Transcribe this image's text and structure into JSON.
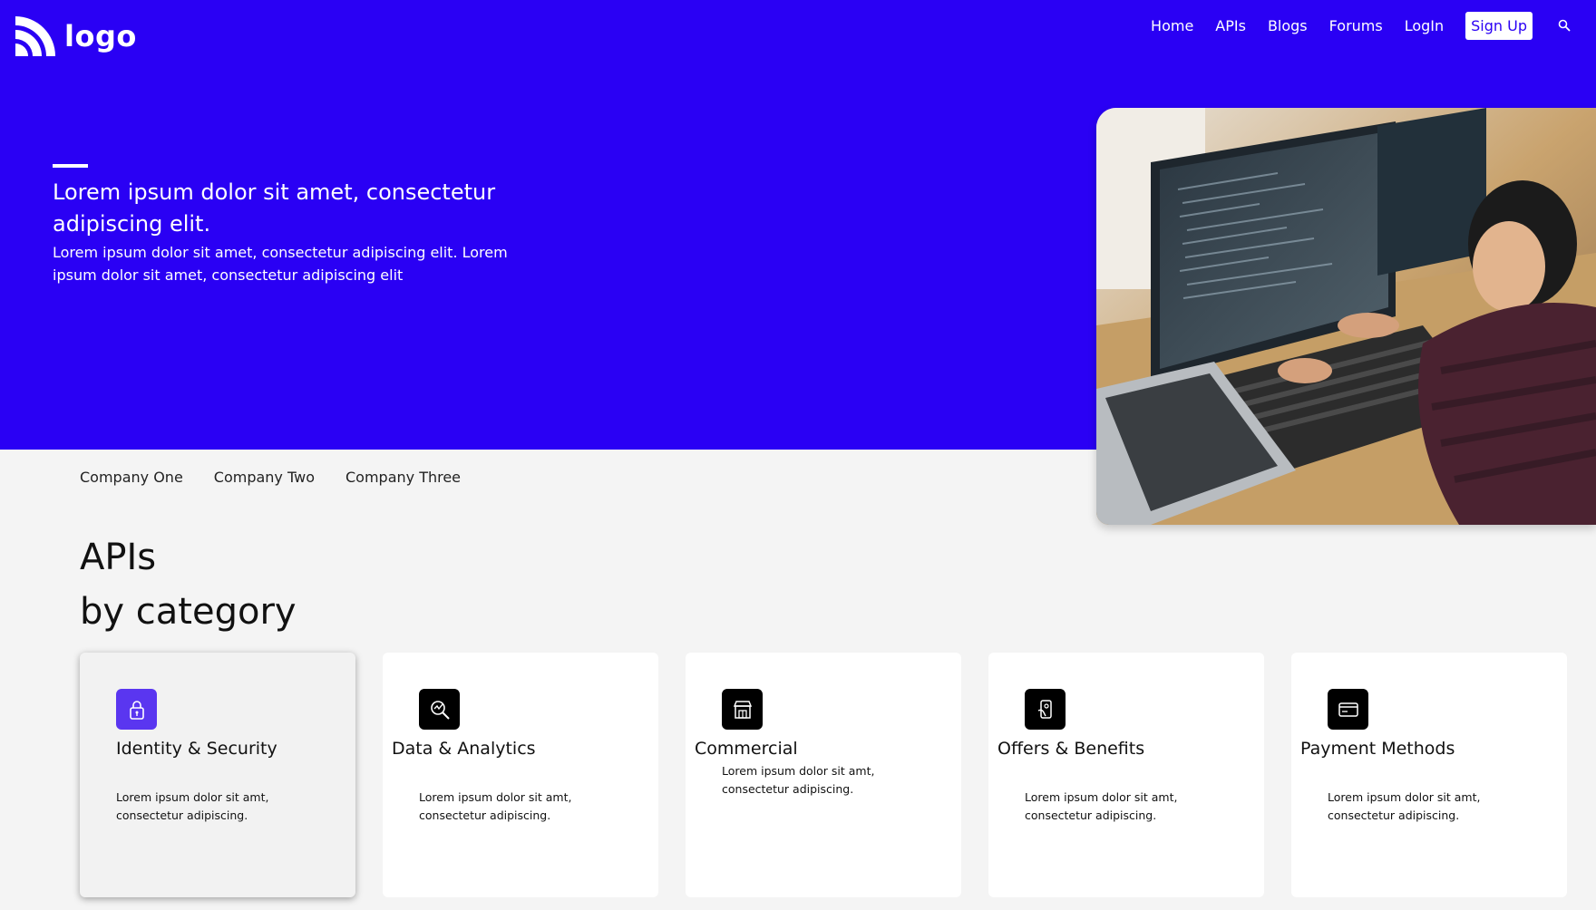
{
  "header": {
    "logo_text": "logo",
    "nav": [
      "Home",
      "APIs",
      "Blogs",
      "Forums",
      "LogIn"
    ],
    "signup_label": "Sign Up"
  },
  "hero": {
    "title": "Lorem ipsum dolor sit amet, consectetur adipiscing elit.",
    "subtitle": "Lorem ipsum dolor sit amet, consectetur adipiscing elit. Lorem ipsum dolor sit amet, consectetur adipiscing elit",
    "image_description": "developer typing code on keyboard in front of two monitors and a laptop"
  },
  "companies": [
    "Company One",
    "Company Two",
    "Company Three"
  ],
  "section": {
    "title_line1": "APIs",
    "title_line2": "by category"
  },
  "categories": [
    {
      "title": "Identity & Security",
      "desc": "Lorem ipsum dolor sit amt, consectetur adipiscing.",
      "icon": "lock-icon",
      "active": true
    },
    {
      "title": "Data & Analytics",
      "desc": "Lorem ipsum dolor sit amt, consectetur adipiscing.",
      "icon": "analytics-search-icon",
      "active": false
    },
    {
      "title": "Commercial",
      "desc": "Lorem ipsum dolor sit amt, consectetur adipiscing.",
      "icon": "storefront-icon",
      "active": false
    },
    {
      "title": "Offers & Benefits",
      "desc": "Lorem ipsum dolor sit amt, consectetur adipiscing.",
      "icon": "mobile-offer-icon",
      "active": false
    },
    {
      "title": "Payment Methods",
      "desc": "Lorem ipsum dolor sit amt, consectetur adipiscing.",
      "icon": "credit-card-icon",
      "active": false
    }
  ],
  "colors": {
    "brand": "#2a00f4",
    "accent": "#5a36f0",
    "page_bg": "#f4f4f4"
  }
}
